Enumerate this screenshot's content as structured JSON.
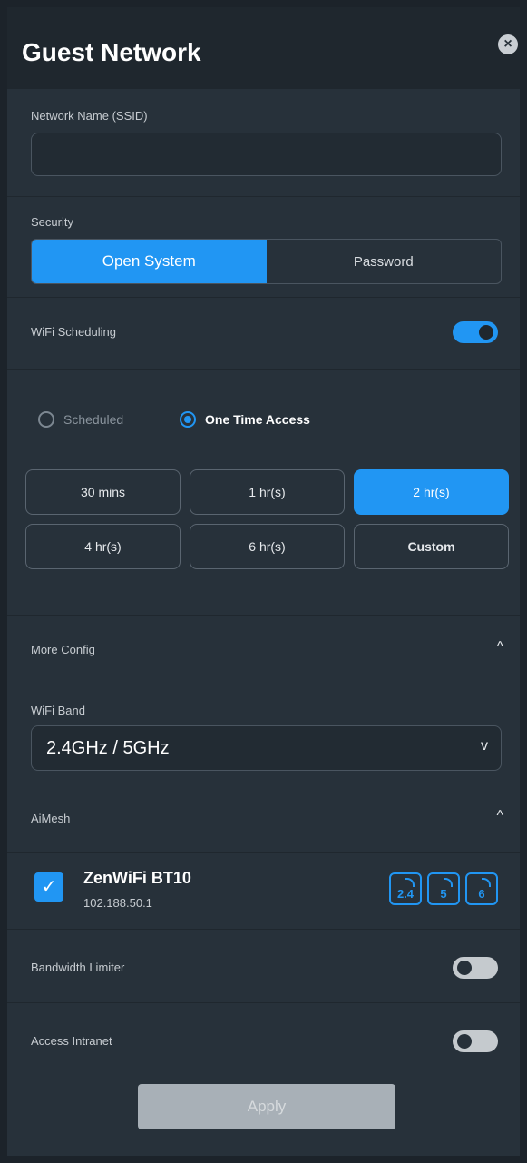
{
  "header": {
    "title": "Guest Network",
    "close_label": "×"
  },
  "ssid": {
    "label": "Network Name (SSID)",
    "value": "",
    "placeholder": ""
  },
  "security": {
    "label": "Security",
    "options": [
      "Open System",
      "Password"
    ],
    "selected": "Open System"
  },
  "scheduling": {
    "label": "WiFi Scheduling",
    "enabled": true
  },
  "schedule_mode": {
    "options": [
      "Scheduled",
      "One Time Access"
    ],
    "selected": "One Time Access"
  },
  "durations": {
    "options": [
      "30 mins",
      "1 hr(s)",
      "2 hr(s)",
      "4 hr(s)",
      "6 hr(s)",
      "Custom"
    ],
    "selected": "2 hr(s)"
  },
  "more_config": {
    "label": "More Config",
    "chevron": "^"
  },
  "wifi_band": {
    "label": "WiFi Band",
    "value": "2.4GHz / 5GHz",
    "caret": "v"
  },
  "aimesh": {
    "label": "AiMesh",
    "chevron": "^",
    "device": {
      "name": "ZenWiFi BT10",
      "ip": "102.188.50.1",
      "checked": true,
      "check_mark": "✓",
      "bands": [
        "2.4",
        "5",
        "6"
      ]
    }
  },
  "bandwidth_limiter": {
    "label": "Bandwidth Limiter",
    "enabled": false
  },
  "access_intranet": {
    "label": "Access Intranet",
    "enabled": false
  },
  "apply_label": "Apply",
  "colors": {
    "accent": "#2196f3",
    "panel": "#27313a",
    "header": "#1f272e"
  }
}
